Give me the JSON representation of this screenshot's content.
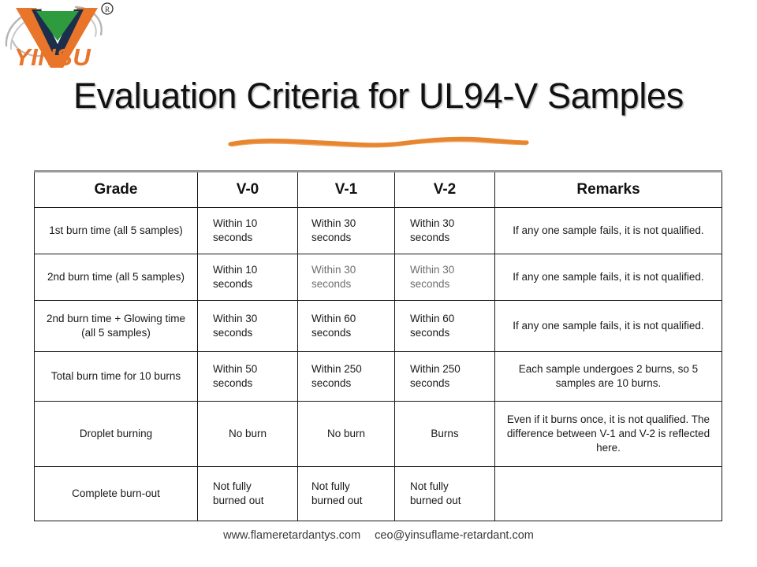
{
  "brand": {
    "name": "YINSU",
    "registered_mark": "®",
    "logo_colors": {
      "orange": "#E8752A",
      "green": "#2E9B3F",
      "dark": "#1B2E4B",
      "swoosh_gray": "#A9A9A9"
    }
  },
  "title": "Evaluation Criteria for UL94-V Samples",
  "divider": {
    "color": "#E8852F"
  },
  "table": {
    "headers": [
      "Grade",
      "V-0",
      "V-1",
      "V-2",
      "Remarks"
    ],
    "rows": [
      {
        "grade": "1st burn time (all 5 samples)",
        "v0": "Within 10 seconds",
        "v1": "Within 30 seconds",
        "v2": "Within 30 seconds",
        "remarks": "If any one sample fails, it is not qualified."
      },
      {
        "grade": "2nd burn time (all 5 samples)",
        "v0": "Within 10 seconds",
        "v1": "Within 30 seconds",
        "v2": "Within 30 seconds",
        "remarks": "If any one sample fails, it is not qualified."
      },
      {
        "grade": "2nd burn time + Glowing time (all 5 samples)",
        "v0": "Within 30 seconds",
        "v1": "Within 60 seconds",
        "v2": "Within 60 seconds",
        "remarks": "If any one sample fails, it is not qualified."
      },
      {
        "grade": "Total burn time for 10 burns",
        "v0": "Within 50 seconds",
        "v1": "Within 250 seconds",
        "v2": "Within 250 seconds",
        "remarks": "Each sample undergoes 2 burns, so 5 samples are 10 burns."
      },
      {
        "grade": "Droplet burning",
        "v0": "No burn",
        "v1": "No burn",
        "v2": "Burns",
        "remarks": "Even if it burns once, it is not qualified. The difference between V-1 and V-2 is reflected here."
      },
      {
        "grade": "Complete burn-out",
        "v0": "Not fully burned out",
        "v1": "Not fully burned out",
        "v2": "Not fully burned out",
        "remarks": ""
      }
    ]
  },
  "footer": {
    "website": "www.flameretardantys.com",
    "email": "ceo@yinsuflame-retardant.com"
  }
}
